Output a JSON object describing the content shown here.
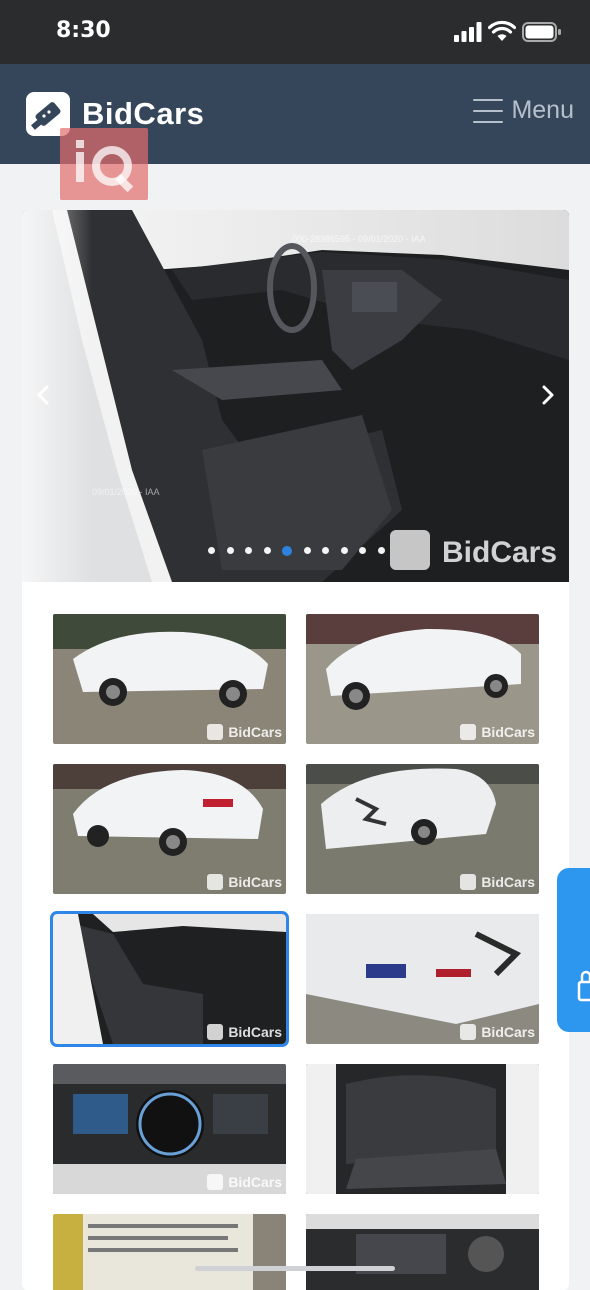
{
  "status_bar": {
    "time": "8:30"
  },
  "header": {
    "brand": "BidCars",
    "menu_label": "Menu"
  },
  "overlay_badge": {
    "text": "iQ"
  },
  "gallery": {
    "main_watermark": "BidCars",
    "main_caption_fragments": [
      "000-28386595 - 09/01/2020 - IAA",
      "09/01/2020 - IAA"
    ],
    "slide_count": 10,
    "active_slide": 5,
    "thumbnails": [
      {
        "label": "BidCars",
        "subject": "front-left exterior"
      },
      {
        "label": "BidCars",
        "subject": "front-right exterior"
      },
      {
        "label": "BidCars",
        "subject": "rear-left exterior"
      },
      {
        "label": "BidCars",
        "subject": "rear-right damage"
      },
      {
        "label": "BidCars",
        "subject": "front interior",
        "selected": true
      },
      {
        "label": "BidCars",
        "subject": "rear damage close-up"
      },
      {
        "label": "BidCars",
        "subject": "instrument cluster"
      },
      {
        "label": "",
        "subject": "rear seats"
      }
    ]
  },
  "colors": {
    "nav": "#35465a",
    "accent": "#2d86e8",
    "side_tab": "#2d96ee"
  }
}
